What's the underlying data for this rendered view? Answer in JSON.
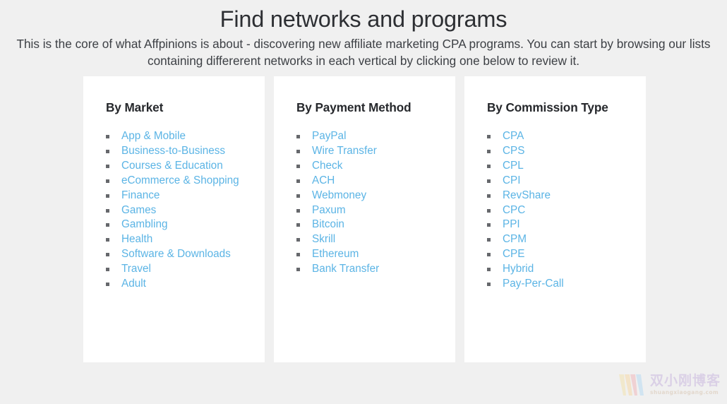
{
  "header": {
    "title": "Find networks and programs",
    "subtitle": "This is the core of what Affpinions is about - discovering new affiliate marketing CPA programs. You can start by browsing our lists containing differerent networks in each vertical by clicking one below to review it."
  },
  "colors": {
    "page_background": "#f0f0f0",
    "card_background": "#ffffff",
    "link": "#5bb4e5",
    "heading": "#26282c",
    "bullet": "#66686c"
  },
  "cards": [
    {
      "title": "By Market",
      "items": [
        "App & Mobile",
        "Business-to-Business",
        "Courses & Education",
        "eCommerce & Shopping",
        "Finance",
        "Games",
        "Gambling",
        "Health",
        "Software & Downloads",
        "Travel",
        "Adult"
      ]
    },
    {
      "title": "By Payment Method",
      "items": [
        "PayPal",
        "Wire Transfer",
        "Check",
        "ACH",
        "Webmoney",
        "Paxum",
        "Bitcoin",
        "Skrill",
        "Ethereum",
        "Bank Transfer"
      ]
    },
    {
      "title": "By Commission Type",
      "items": [
        "CPA",
        "CPS",
        "CPL",
        "CPI",
        "RevShare",
        "CPC",
        "PPI",
        "CPM",
        "CPE",
        "Hybrid",
        "Pay-Per-Call"
      ]
    }
  ],
  "watermark": {
    "logo_name": "w-logo-icon",
    "chinese_text": "双小刚博客",
    "url": "shuangxiaogang.com"
  }
}
